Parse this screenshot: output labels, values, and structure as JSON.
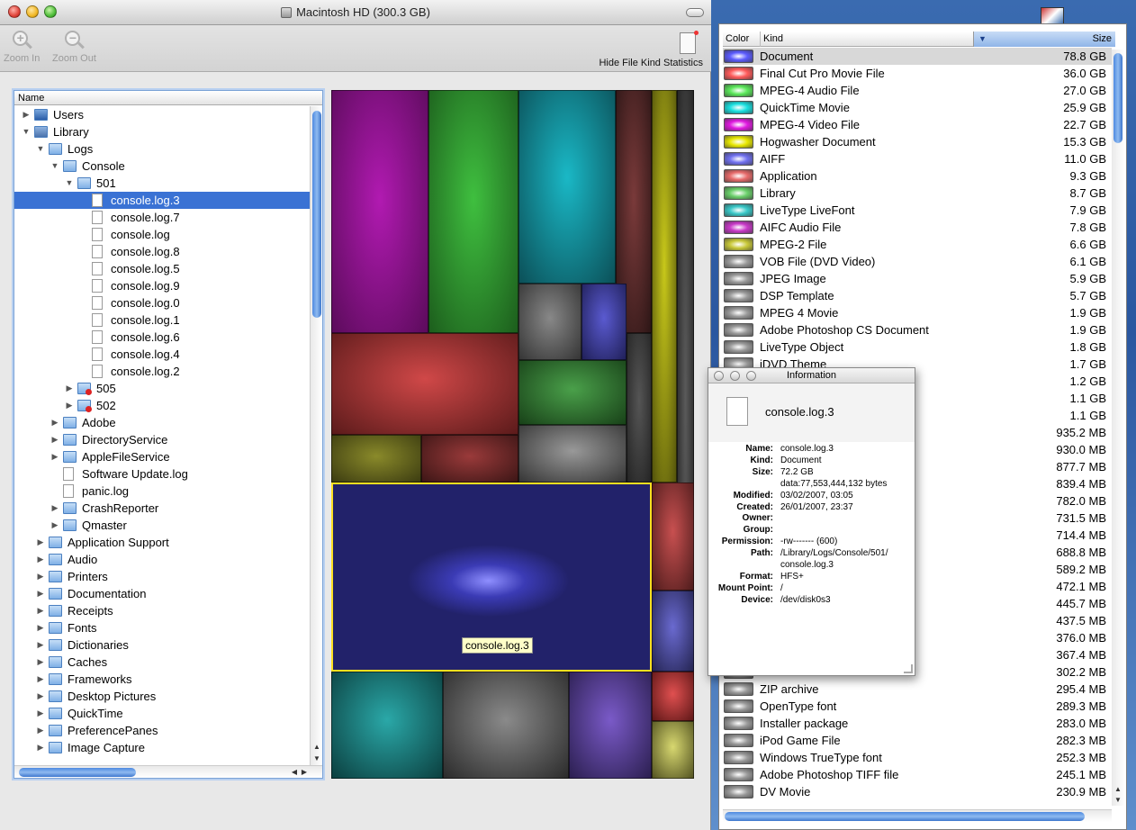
{
  "window": {
    "title": "Macintosh HD (300.3 GB)"
  },
  "toolbar": {
    "zoom_in": "Zoom In",
    "zoom_out": "Zoom Out",
    "hide_stats": "Hide File Kind Statistics"
  },
  "tree": {
    "header": "Name",
    "rows": [
      {
        "label": "Users",
        "depth": 0,
        "expanded": false,
        "icon": "home-folder-icon"
      },
      {
        "label": "Library",
        "depth": 0,
        "expanded": true,
        "icon": "library-folder-icon"
      },
      {
        "label": "Logs",
        "depth": 1,
        "expanded": true,
        "icon": "folder-icon"
      },
      {
        "label": "Console",
        "depth": 2,
        "expanded": true,
        "icon": "folder-icon"
      },
      {
        "label": "501",
        "depth": 3,
        "expanded": true,
        "icon": "folder-icon"
      },
      {
        "label": "console.log.3",
        "depth": 4,
        "icon": "document-icon",
        "selected": true
      },
      {
        "label": "console.log.7",
        "depth": 4,
        "icon": "document-icon"
      },
      {
        "label": "console.log",
        "depth": 4,
        "icon": "document-icon"
      },
      {
        "label": "console.log.8",
        "depth": 4,
        "icon": "document-icon"
      },
      {
        "label": "console.log.5",
        "depth": 4,
        "icon": "document-icon"
      },
      {
        "label": "console.log.9",
        "depth": 4,
        "icon": "document-icon"
      },
      {
        "label": "console.log.0",
        "depth": 4,
        "icon": "document-icon"
      },
      {
        "label": "console.log.1",
        "depth": 4,
        "icon": "document-icon"
      },
      {
        "label": "console.log.6",
        "depth": 4,
        "icon": "document-icon"
      },
      {
        "label": "console.log.4",
        "depth": 4,
        "icon": "document-icon"
      },
      {
        "label": "console.log.2",
        "depth": 4,
        "icon": "document-icon"
      },
      {
        "label": "505",
        "depth": 3,
        "expanded": false,
        "icon": "locked-folder-icon"
      },
      {
        "label": "502",
        "depth": 3,
        "expanded": false,
        "icon": "locked-folder-icon"
      },
      {
        "label": "Adobe",
        "depth": 2,
        "expanded": false,
        "icon": "folder-icon"
      },
      {
        "label": "DirectoryService",
        "depth": 2,
        "expanded": false,
        "icon": "folder-icon"
      },
      {
        "label": "AppleFileService",
        "depth": 2,
        "expanded": false,
        "icon": "folder-icon"
      },
      {
        "label": "Software Update.log",
        "depth": 2,
        "icon": "document-icon"
      },
      {
        "label": "panic.log",
        "depth": 2,
        "icon": "document-icon"
      },
      {
        "label": "CrashReporter",
        "depth": 2,
        "expanded": false,
        "icon": "folder-icon"
      },
      {
        "label": "Qmaster",
        "depth": 2,
        "expanded": false,
        "icon": "folder-icon"
      },
      {
        "label": "Application Support",
        "depth": 1,
        "expanded": false,
        "icon": "folder-icon"
      },
      {
        "label": "Audio",
        "depth": 1,
        "expanded": false,
        "icon": "folder-icon"
      },
      {
        "label": "Printers",
        "depth": 1,
        "expanded": false,
        "icon": "folder-icon"
      },
      {
        "label": "Documentation",
        "depth": 1,
        "expanded": false,
        "icon": "folder-icon"
      },
      {
        "label": "Receipts",
        "depth": 1,
        "expanded": false,
        "icon": "folder-icon"
      },
      {
        "label": "Fonts",
        "depth": 1,
        "expanded": false,
        "icon": "folder-icon"
      },
      {
        "label": "Dictionaries",
        "depth": 1,
        "expanded": false,
        "icon": "folder-icon"
      },
      {
        "label": "Caches",
        "depth": 1,
        "expanded": false,
        "icon": "folder-icon"
      },
      {
        "label": "Frameworks",
        "depth": 1,
        "expanded": false,
        "icon": "folder-icon"
      },
      {
        "label": "Desktop Pictures",
        "depth": 1,
        "expanded": false,
        "icon": "folder-icon"
      },
      {
        "label": "QuickTime",
        "depth": 1,
        "expanded": false,
        "icon": "folder-icon"
      },
      {
        "label": "PreferencePanes",
        "depth": 1,
        "expanded": false,
        "icon": "folder-icon"
      },
      {
        "label": "Image Capture",
        "depth": 1,
        "expanded": false,
        "icon": "folder-icon"
      }
    ]
  },
  "treemap": {
    "tooltip": "console.log.3"
  },
  "kinds": {
    "headers": {
      "color": "Color",
      "kind": "Kind",
      "size": "Size"
    },
    "rows": [
      {
        "kind": "Document",
        "size": "78.8 GB",
        "color": "#5b5bff",
        "selected": true
      },
      {
        "kind": "Final Cut Pro Movie File",
        "size": "36.0 GB",
        "color": "#ff5a5a"
      },
      {
        "kind": "MPEG-4 Audio File",
        "size": "27.0 GB",
        "color": "#5ae85a"
      },
      {
        "kind": "QuickTime Movie",
        "size": "25.9 GB",
        "color": "#18e0e0"
      },
      {
        "kind": "MPEG-4 Video File",
        "size": "22.7 GB",
        "color": "#e018e0"
      },
      {
        "kind": "Hogwasher Document",
        "size": "15.3 GB",
        "color": "#e8e800"
      },
      {
        "kind": "AIFF",
        "size": "11.0 GB",
        "color": "#7070f0"
      },
      {
        "kind": "Application",
        "size": "9.3 GB",
        "color": "#e86a6a"
      },
      {
        "kind": "Library",
        "size": "8.7 GB",
        "color": "#6ad06a"
      },
      {
        "kind": "LiveType LiveFont",
        "size": "7.9 GB",
        "color": "#38c8c8"
      },
      {
        "kind": "AIFC Audio File",
        "size": "7.8 GB",
        "color": "#c838c8"
      },
      {
        "kind": "MPEG-2 File",
        "size": "6.6 GB",
        "color": "#c8c838"
      },
      {
        "kind": "VOB File (DVD Video)",
        "size": "6.1 GB",
        "color": "#9a9a9a"
      },
      {
        "kind": "JPEG Image",
        "size": "5.9 GB",
        "color": "#9a9a9a"
      },
      {
        "kind": "DSP Template",
        "size": "5.7 GB",
        "color": "#9a9a9a"
      },
      {
        "kind": "MPEG 4 Movie",
        "size": "1.9 GB",
        "color": "#9a9a9a"
      },
      {
        "kind": "Adobe Photoshop CS Document",
        "size": "1.9 GB",
        "color": "#9a9a9a"
      },
      {
        "kind": "LiveType Object",
        "size": "1.8 GB",
        "color": "#9a9a9a"
      },
      {
        "kind": "iDVD Theme",
        "size": "1.7 GB",
        "color": "#9a9a9a"
      },
      {
        "kind": "",
        "size": "1.2 GB",
        "color": "#9a9a9a"
      },
      {
        "kind": "",
        "size": "1.1 GB",
        "color": "#9a9a9a"
      },
      {
        "kind": "",
        "size": "1.1 GB",
        "color": "#9a9a9a"
      },
      {
        "kind": "",
        "size": "935.2 MB",
        "color": "#9a9a9a"
      },
      {
        "kind": "",
        "size": "930.0 MB",
        "color": "#9a9a9a"
      },
      {
        "kind": "",
        "size": "877.7 MB",
        "color": "#9a9a9a"
      },
      {
        "kind": "",
        "size": "839.4 MB",
        "color": "#9a9a9a"
      },
      {
        "kind": "",
        "size": "782.0 MB",
        "color": "#9a9a9a"
      },
      {
        "kind": "",
        "size": "731.5 MB",
        "color": "#9a9a9a"
      },
      {
        "kind": "",
        "size": "714.4 MB",
        "color": "#9a9a9a"
      },
      {
        "kind": "ed)",
        "size": "688.8 MB",
        "color": "#9a9a9a"
      },
      {
        "kind": "",
        "size": "589.2 MB",
        "color": "#9a9a9a"
      },
      {
        "kind": "",
        "size": "472.1 MB",
        "color": "#9a9a9a"
      },
      {
        "kind": "",
        "size": "445.7 MB",
        "color": "#9a9a9a"
      },
      {
        "kind": "t",
        "size": "437.5 MB",
        "color": "#9a9a9a"
      },
      {
        "kind": "",
        "size": "376.0 MB",
        "color": "#9a9a9a"
      },
      {
        "kind": "",
        "size": "367.4 MB",
        "color": "#9a9a9a"
      },
      {
        "kind": "",
        "size": "302.2 MB",
        "color": "#9a9a9a"
      },
      {
        "kind": "ZIP archive",
        "size": "295.4 MB",
        "color": "#9a9a9a"
      },
      {
        "kind": "OpenType font",
        "size": "289.3 MB",
        "color": "#9a9a9a"
      },
      {
        "kind": "Installer package",
        "size": "283.0 MB",
        "color": "#9a9a9a"
      },
      {
        "kind": "iPod Game File",
        "size": "282.3 MB",
        "color": "#9a9a9a"
      },
      {
        "kind": "Windows TrueType font",
        "size": "252.3 MB",
        "color": "#9a9a9a"
      },
      {
        "kind": "Adobe Photoshop TIFF file",
        "size": "245.1 MB",
        "color": "#9a9a9a"
      },
      {
        "kind": "DV Movie",
        "size": "230.9 MB",
        "color": "#9a9a9a"
      }
    ]
  },
  "info": {
    "title": "Information",
    "name": "console.log.3",
    "fields": [
      {
        "label": "Name:",
        "value": "console.log.3"
      },
      {
        "label": "Kind:",
        "value": "Document"
      },
      {
        "label": "Size:",
        "value": "72.2 GB"
      },
      {
        "label": "",
        "value": "data:77,553,444,132 bytes"
      },
      {
        "label": "Modified:",
        "value": "03/02/2007, 03:05"
      },
      {
        "label": "Created:",
        "value": "26/01/2007, 23:37"
      },
      {
        "label": "Owner:",
        "value": ""
      },
      {
        "label": "Group:",
        "value": ""
      },
      {
        "label": "Permission:",
        "value": "-rw------- (600)"
      },
      {
        "label": "Path:",
        "value": "/Library/Logs/Console/501/"
      },
      {
        "label": "",
        "value": "console.log.3"
      },
      {
        "label": "Format:",
        "value": "HFS+"
      },
      {
        "label": "Mount Point:",
        "value": "/"
      },
      {
        "label": "Device:",
        "value": "/dev/disk0s3"
      }
    ]
  }
}
